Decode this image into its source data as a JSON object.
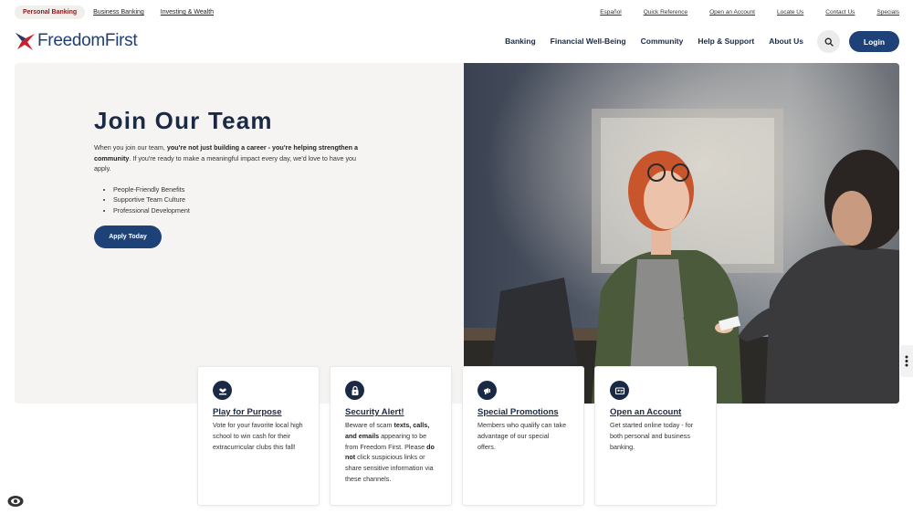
{
  "util_bar": {
    "segments": [
      {
        "label": "Personal Banking",
        "active": true
      },
      {
        "label": "Business Banking",
        "active": false
      },
      {
        "label": "Investing & Wealth",
        "active": false
      }
    ],
    "links": [
      "Español",
      "Quick Reference",
      "Open an Account",
      "Locate Us",
      "Contact Us",
      "Specials"
    ]
  },
  "nav": {
    "logo_text": "FreedomFirst",
    "links": [
      "Banking",
      "Financial Well-Being",
      "Community",
      "Help & Support",
      "About Us"
    ],
    "search_icon": "search-icon",
    "login_label": "Login"
  },
  "hero": {
    "title": "Join Our Team",
    "body_1": "When you join our team, ",
    "body_bold": "you're not just building a career - you're helping strengthen a community",
    "body_2": ". If you're ready to make a meaningful impact every day, we'd love to have you apply.",
    "list": [
      "People-Friendly Benefits",
      "Supportive Team Culture",
      "Professional Development"
    ],
    "apply_label": "Apply Today"
  },
  "cards": [
    {
      "icon": "hand-heart-icon",
      "title": "Play for Purpose",
      "body": [
        {
          "text": "Vote for your favorite local high school to win cash for their extracurricular clubs this fall!",
          "bold": false
        }
      ]
    },
    {
      "icon": "lock-icon",
      "title": "Security Alert!",
      "body": [
        {
          "text": "Beware of scam ",
          "bold": false
        },
        {
          "text": "texts, calls, and emails",
          "bold": true
        },
        {
          "text": " appearing to be from Freedom First. Please ",
          "bold": false
        },
        {
          "text": "do not",
          "bold": true
        },
        {
          "text": " click suspicious links or share sensitive information via these channels.",
          "bold": false
        }
      ]
    },
    {
      "icon": "megaphone-icon",
      "title": "Special Promotions",
      "body": [
        {
          "text": "Members who qualify can take advantage of our special offers.",
          "bold": false
        }
      ]
    },
    {
      "icon": "account-card-icon",
      "title": "Open an Account",
      "body": [
        {
          "text": "Get started online today - for both personal and business banking.",
          "bold": false
        }
      ]
    }
  ],
  "colors": {
    "brand_navy": "#1e4278",
    "brand_red": "#c8202f",
    "hero_bg": "#f5f4f2"
  }
}
